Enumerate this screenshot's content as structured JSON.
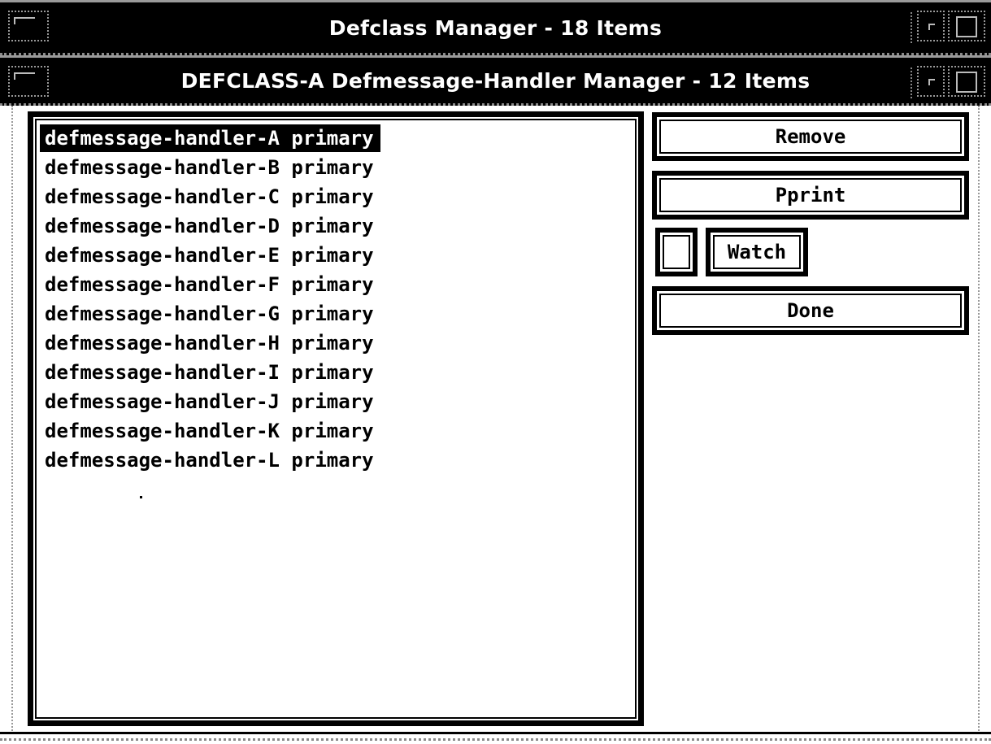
{
  "outer_window": {
    "title": "Defclass Manager - 18 Items"
  },
  "dialog": {
    "title": "DEFCLASS-A Defmessage-Handler Manager - 12 Items",
    "list_items": [
      "defmessage-handler-A primary",
      "defmessage-handler-B primary",
      "defmessage-handler-C primary",
      "defmessage-handler-D primary",
      "defmessage-handler-E primary",
      "defmessage-handler-F primary",
      "defmessage-handler-G primary",
      "defmessage-handler-H primary",
      "defmessage-handler-I primary",
      "defmessage-handler-J primary",
      "defmessage-handler-K primary",
      "defmessage-handler-L primary"
    ],
    "selected_item": "defmessage-handler-A primary",
    "buttons": {
      "remove": "Remove",
      "pprint": "Pprint",
      "watch": "Watch",
      "done": "Done"
    },
    "watch_checked": false
  }
}
